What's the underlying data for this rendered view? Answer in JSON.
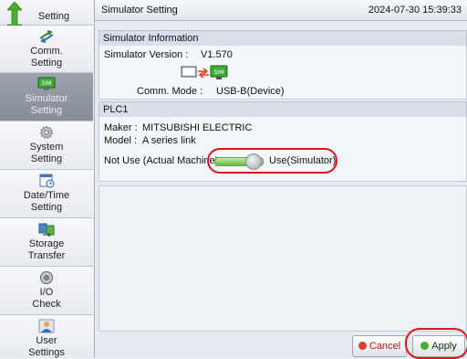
{
  "sidebar": {
    "items": [
      {
        "label": "Setting"
      },
      {
        "label": "Comm.\nSetting"
      },
      {
        "label": "Simulator\nSetting"
      },
      {
        "label": "System\nSetting"
      },
      {
        "label": "Date/Time\nSetting"
      },
      {
        "label": "Storage\nTransfer"
      },
      {
        "label": "I/O\nCheck"
      },
      {
        "label": "User\nSettings"
      }
    ]
  },
  "titlebar": {
    "title": "Simulator Setting",
    "datetime": "2024-07-30 15:39:33"
  },
  "sim_info": {
    "header": "Simulator Information",
    "version_label": "Simulator Version :",
    "version_value": "V1.570",
    "comm_mode_label": "Comm. Mode :",
    "comm_mode_value": "USB-B(Device)"
  },
  "plc": {
    "header": "PLC1",
    "maker_label": "Maker :",
    "maker_value": "MITSUBISHI ELECTRIC",
    "model_label": "Model :",
    "model_value": "A series link",
    "left_option": "Not Use (Actual Machine)",
    "right_option": "Use(Simulator)",
    "toggle_on": true
  },
  "footer": {
    "cancel_label": "Cancel",
    "apply_label": "Apply"
  },
  "colors": {
    "highlight_ring": "#e0151b",
    "toggle_green": "#5fbf3c"
  }
}
